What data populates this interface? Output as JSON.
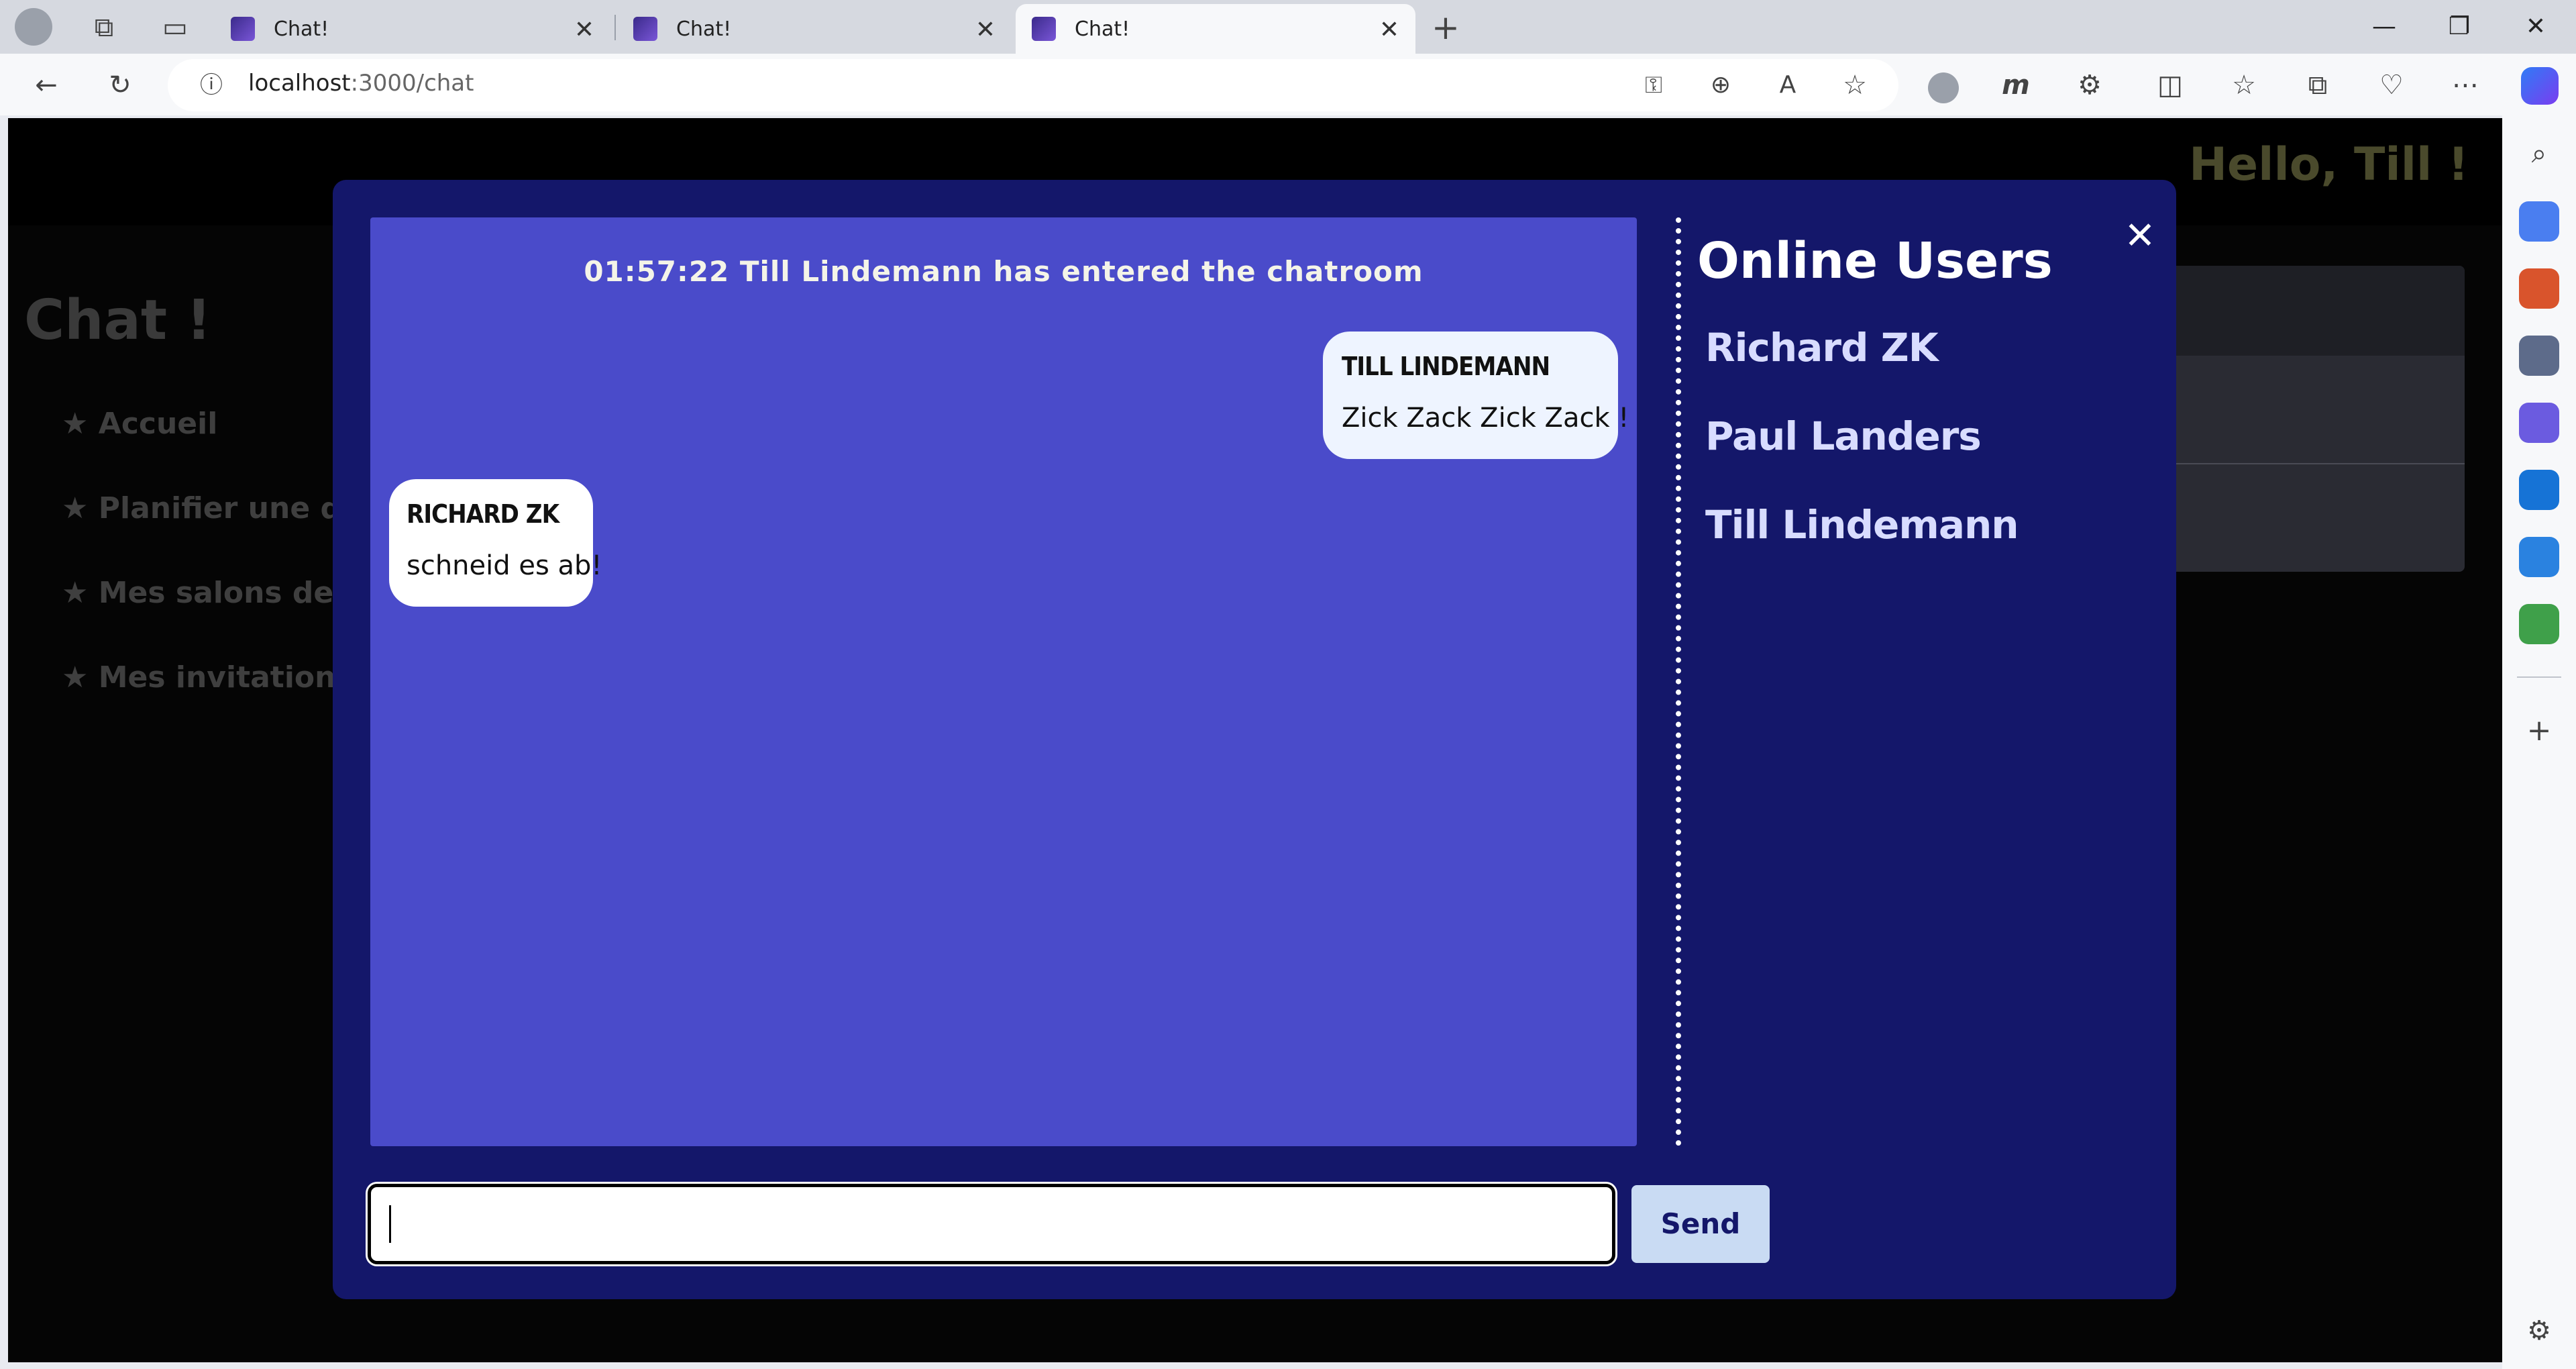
{
  "browser": {
    "tabs": [
      {
        "title": "Chat!"
      },
      {
        "title": "Chat!"
      },
      {
        "title": "Chat!"
      }
    ],
    "url_host": "localhost",
    "url_path": ":3000/chat",
    "new_tab": "+",
    "window_controls": {
      "minimize": "—",
      "restore": "❐",
      "close": "✕"
    }
  },
  "page": {
    "greeting": "Hello, Till !",
    "title": "Chat !",
    "nav": [
      {
        "label": "★ Accueil"
      },
      {
        "label": "★ Planifier une dis"
      },
      {
        "label": "★ Mes salons de d"
      },
      {
        "label": "★ Mes invitations"
      }
    ]
  },
  "chat": {
    "system_message": "01:57:22 Till Lindemann has entered the chatroom",
    "messages": [
      {
        "author": "TILL LINDEMANN",
        "text": "Zick Zack Zick Zack !",
        "mine": true
      },
      {
        "author": "RICHARD ZK",
        "text": "schneid es ab!",
        "mine": false
      }
    ],
    "input_value": "",
    "send_label": "Send",
    "close_label": "✕"
  },
  "online": {
    "title": "Online Users",
    "users": [
      "Richard ZK",
      "Paul Landers",
      "Till Lindemann"
    ]
  }
}
